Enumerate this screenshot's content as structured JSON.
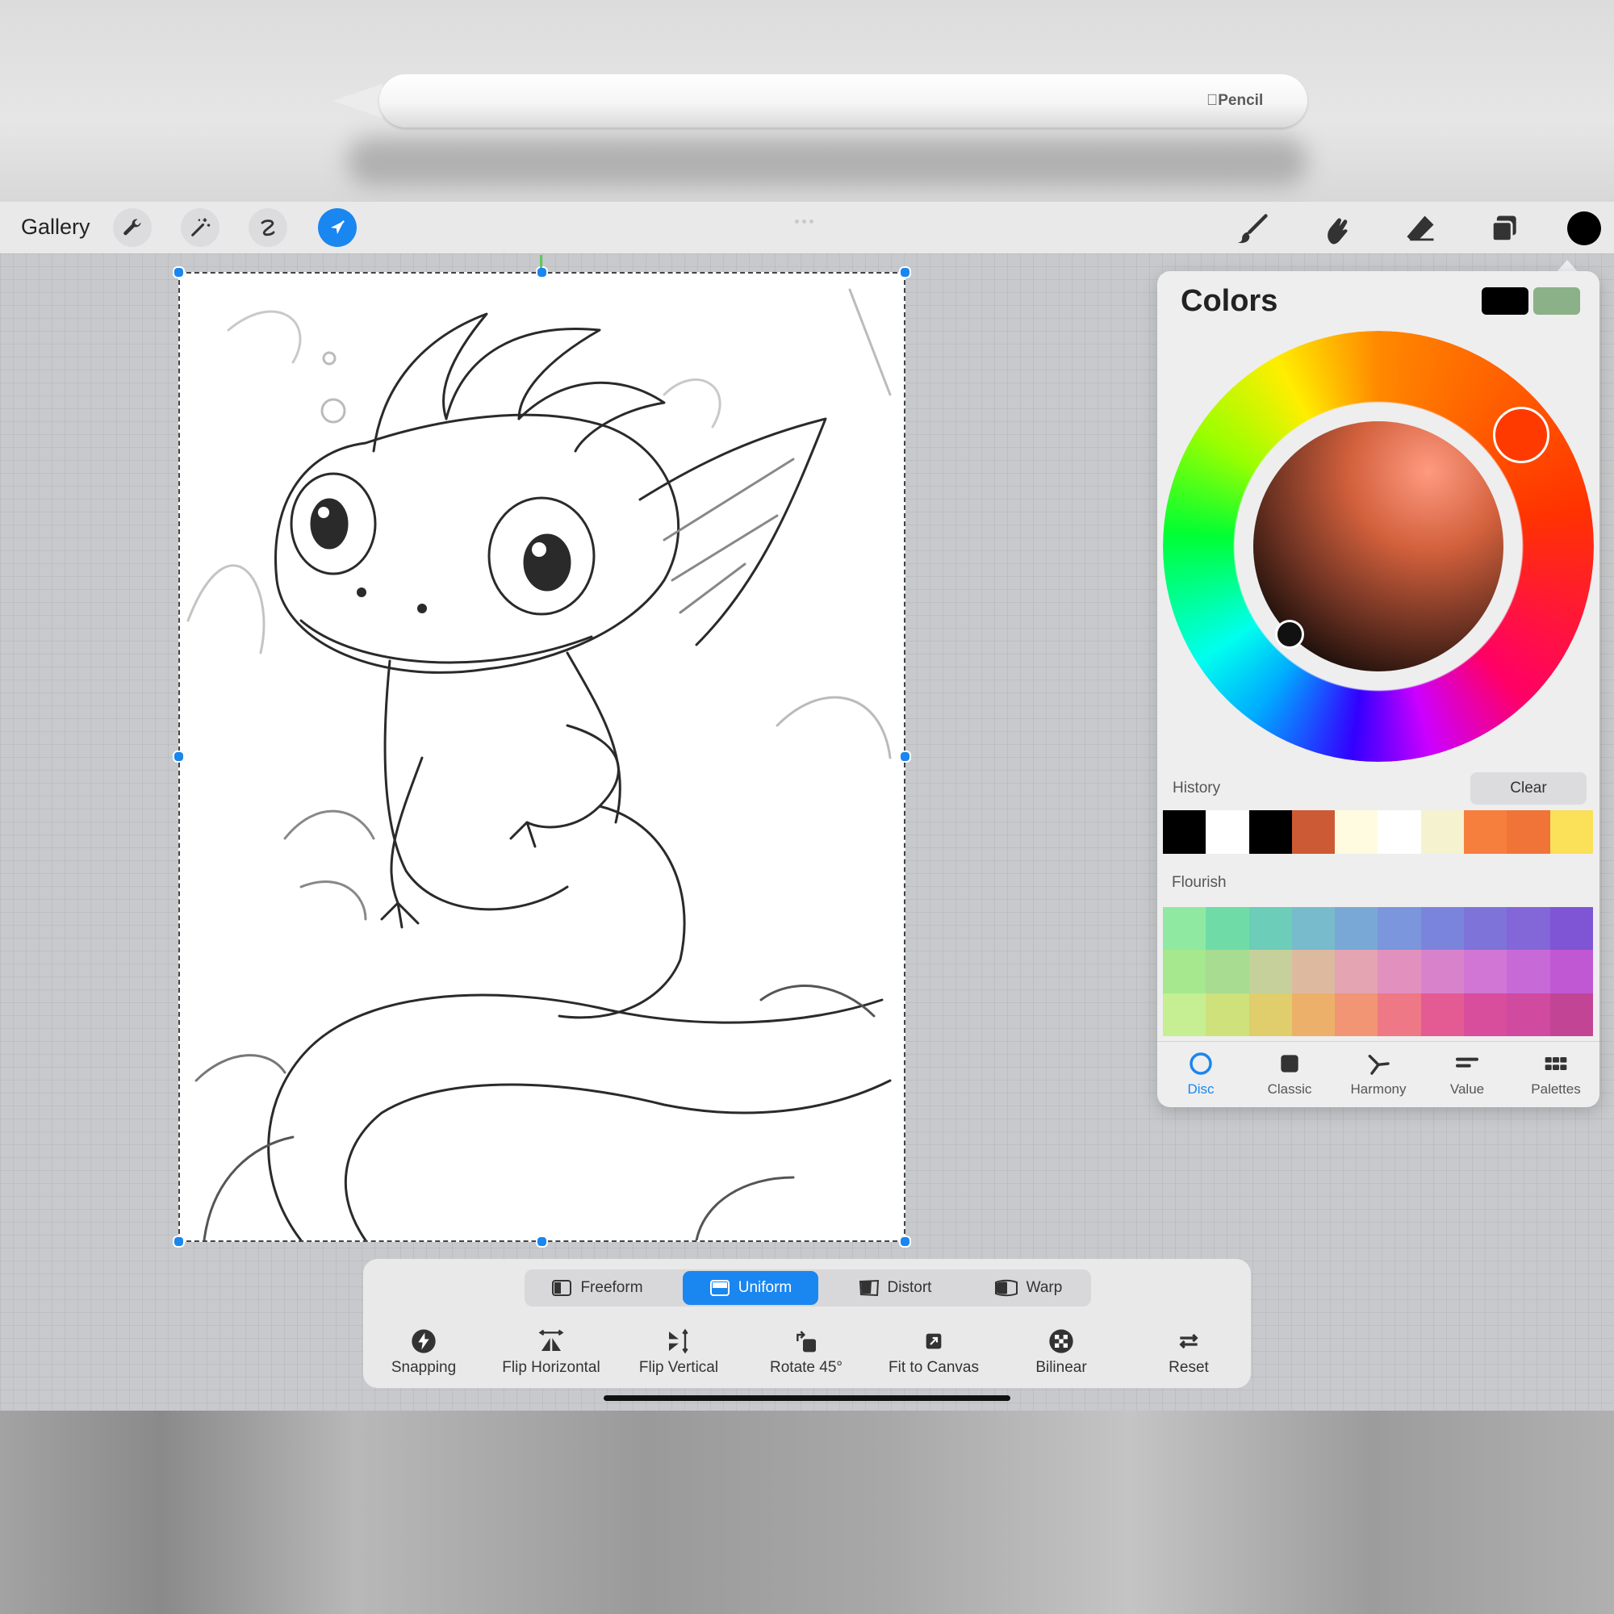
{
  "pencil": {
    "brand": "Pencil"
  },
  "toolbar": {
    "gallery_label": "Gallery",
    "left_tools": [
      "wrench-icon",
      "magic-wand-icon",
      "selection-icon",
      "transform-arrow-icon"
    ],
    "right_tools": [
      "brush-icon",
      "smudge-icon",
      "eraser-icon",
      "layers-icon",
      "color-dot-icon"
    ],
    "active_tool": "transform-arrow-icon"
  },
  "transform": {
    "modes": [
      {
        "label": "Freeform",
        "active": false
      },
      {
        "label": "Uniform",
        "active": true
      },
      {
        "label": "Distort",
        "active": false
      },
      {
        "label": "Warp",
        "active": false
      }
    ],
    "tools": [
      {
        "label": "Snapping",
        "icon": "lightning-icon"
      },
      {
        "label": "Flip Horizontal",
        "icon": "flip-horizontal-icon"
      },
      {
        "label": "Flip Vertical",
        "icon": "flip-vertical-icon"
      },
      {
        "label": "Rotate 45°",
        "icon": "rotate-icon"
      },
      {
        "label": "Fit to Canvas",
        "icon": "fit-canvas-icon"
      },
      {
        "label": "Bilinear",
        "icon": "bilinear-icon"
      },
      {
        "label": "Reset",
        "icon": "reset-icon"
      }
    ]
  },
  "colors": {
    "title": "Colors",
    "primary_color": "#000000",
    "secondary_color": "#8ab187",
    "history_label": "History",
    "clear_label": "Clear",
    "history": [
      "#000000",
      "#ffffff",
      "#000000",
      "#cc5b35",
      "#fffbe0",
      "#ffffff",
      "#f5f2d0",
      "#f77f3e",
      "#f07438",
      "#fbe05a"
    ],
    "flourish_label": "Flourish",
    "flourish": [
      [
        "#8fe9a0",
        "#6fdca8",
        "#6ccdb8",
        "#78bbcc",
        "#7aa8d6",
        "#7b96dc",
        "#7b84dc",
        "#7e73d8",
        "#8366d8",
        "#7f55d6"
      ],
      [
        "#a5e88d",
        "#a7dc91",
        "#c6d09a",
        "#ddb9a0",
        "#e4a4b2",
        "#e291bf",
        "#d982cc",
        "#d176d4",
        "#c76ad8",
        "#c058d3"
      ],
      [
        "#c6ef93",
        "#cfe17b",
        "#e0cd6c",
        "#edb06a",
        "#f19575",
        "#ee7886",
        "#e45a93",
        "#d84d9c",
        "#d04a9f",
        "#c24595"
      ]
    ],
    "modes": [
      {
        "label": "Disc",
        "icon": "disc-icon",
        "active": true
      },
      {
        "label": "Classic",
        "icon": "classic-square-icon",
        "active": false
      },
      {
        "label": "Harmony",
        "icon": "harmony-icon",
        "active": false
      },
      {
        "label": "Value",
        "icon": "value-sliders-icon",
        "active": false
      },
      {
        "label": "Palettes",
        "icon": "palettes-grid-icon",
        "active": false
      }
    ]
  }
}
